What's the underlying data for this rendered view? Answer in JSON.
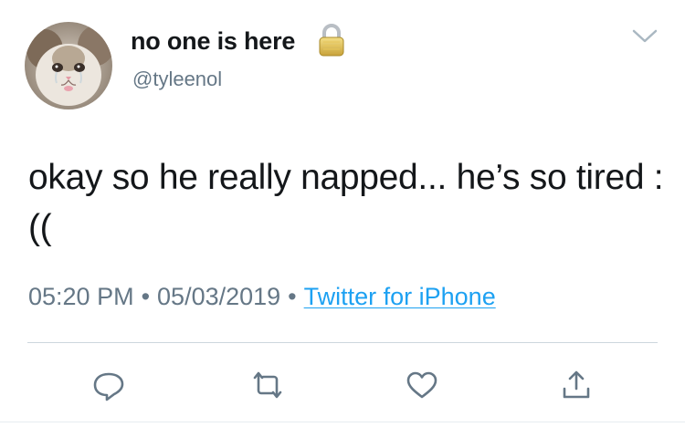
{
  "user": {
    "display_name": "no one is here",
    "handle": "@tyleenol",
    "protected_icon": "lock-icon"
  },
  "tweet": {
    "text": "okay so he really napped... he’s so tired :((",
    "time": "05:20 PM",
    "date": "05/03/2019",
    "separator": "•",
    "source": "Twitter for iPhone"
  },
  "actions": {
    "reply_icon": "reply-icon",
    "retweet_icon": "retweet-icon",
    "like_icon": "heart-icon",
    "share_icon": "share-icon"
  },
  "colors": {
    "text": "#14171a",
    "muted": "#657786",
    "link": "#1da1f2",
    "icon": "#657786"
  }
}
